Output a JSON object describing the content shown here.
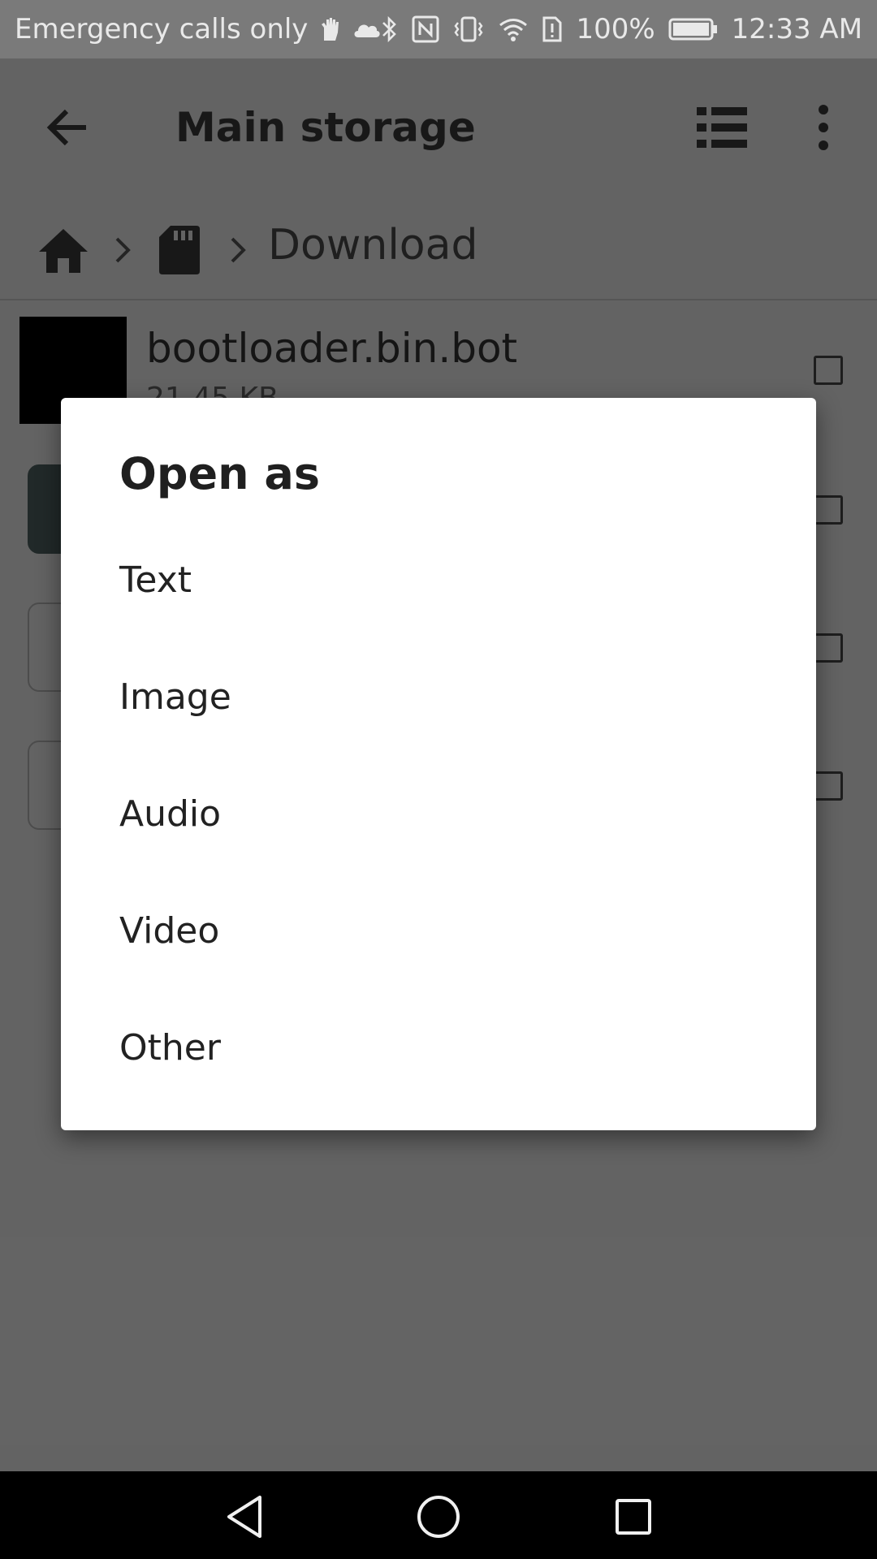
{
  "status_bar": {
    "carrier_text": "Emergency calls only",
    "battery_percent": "100%",
    "time": "12:33 AM"
  },
  "app_bar": {
    "title": "Main storage"
  },
  "breadcrumb": {
    "current_folder": "Download"
  },
  "file_list": {
    "items": [
      {
        "name": "bootloader.bin.bot",
        "size": "21.45 KB"
      }
    ]
  },
  "dialog": {
    "title": "Open as",
    "options": [
      "Text",
      "Image",
      "Audio",
      "Video",
      "Other"
    ]
  },
  "colors": {
    "dialog_bg": "#ffffff",
    "scrim": "#000000",
    "navbar": "#000000"
  },
  "icons": {
    "status": [
      "hand-icon",
      "cloud-icon",
      "bluetooth-icon",
      "nfc-icon",
      "vibrate-icon",
      "wifi-icon",
      "sim-alert-icon",
      "battery-icon"
    ],
    "app_bar": [
      "back-arrow-icon",
      "list-view-icon",
      "overflow-menu-icon"
    ],
    "breadcrumb": [
      "home-icon",
      "chevron-right-icon",
      "sd-card-icon"
    ],
    "navigation": [
      "nav-back-icon",
      "nav-home-icon",
      "nav-recents-icon"
    ]
  }
}
